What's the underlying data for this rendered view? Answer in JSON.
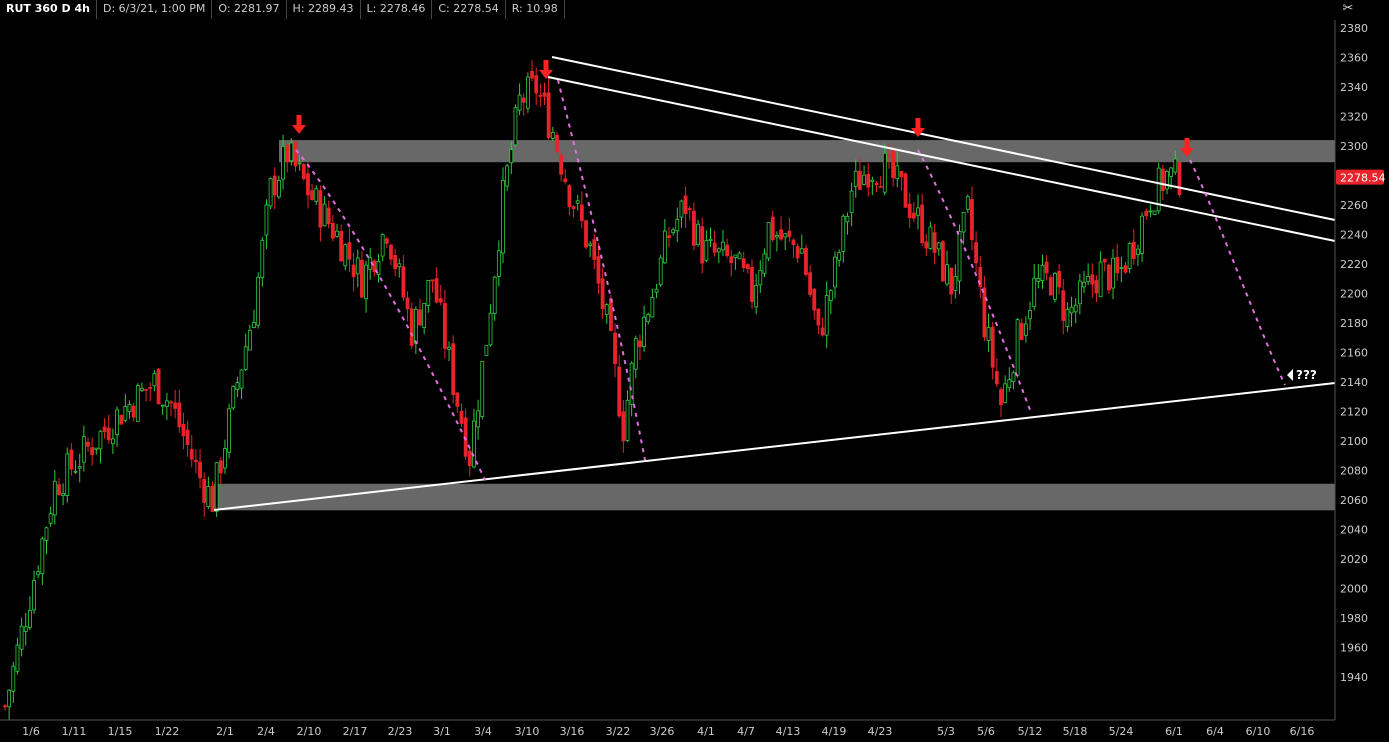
{
  "header": {
    "symbol": "RUT 360 D 4h",
    "date": "D: 6/3/21, 1:00 PM",
    "open": "O: 2281.97",
    "high": "H: 2289.43",
    "low": "L: 2278.46",
    "close": "C: 2278.54",
    "range": "R: 10.98"
  },
  "settings_icon": "settings-wrench-icon",
  "colors": {
    "background": "#000000",
    "up_candle": "#2ecc40",
    "down_candle": "#e8232b",
    "trendline": "#ffffff",
    "zone": "#7a7a7a",
    "projection": "#e070e0",
    "marker": "#ff2020",
    "price_badge": "#e8232b"
  },
  "chart_data": {
    "type": "candlestick",
    "ylim": [
      1910,
      2390
    ],
    "y_ticks": [
      1940,
      1960,
      1980,
      2000,
      2020,
      2040,
      2060,
      2080,
      2100,
      2120,
      2140,
      2160,
      2180,
      2200,
      2220,
      2240,
      2260,
      2280,
      2300,
      2320,
      2340,
      2360,
      2380
    ],
    "x_ticks": [
      "1/6",
      "1/11",
      "1/15",
      "1/22",
      "2/1",
      "2/4",
      "2/10",
      "2/17",
      "2/23",
      "3/1",
      "3/4",
      "3/10",
      "3/16",
      "3/22",
      "3/26",
      "4/1",
      "4/7",
      "4/13",
      "4/19",
      "4/23",
      "5/3",
      "5/6",
      "5/12",
      "5/18",
      "5/24",
      "6/1",
      "6/4",
      "6/10",
      "6/16"
    ],
    "last_price": "2278.54",
    "annotation": "???",
    "zones": [
      {
        "name": "resistance-zone",
        "low": 2289,
        "high": 2304
      },
      {
        "name": "support-zone",
        "low": 2053,
        "high": 2071
      }
    ],
    "anchors": [
      {
        "t": 0,
        "c": 1920
      },
      {
        "t": 6,
        "c": 1995
      },
      {
        "t": 12,
        "c": 2070
      },
      {
        "t": 20,
        "c": 2095
      },
      {
        "t": 28,
        "c": 2120
      },
      {
        "t": 36,
        "c": 2140
      },
      {
        "t": 40,
        "c": 2125
      },
      {
        "t": 47,
        "c": 2075
      },
      {
        "t": 50,
        "c": 2060
      },
      {
        "t": 56,
        "c": 2140
      },
      {
        "t": 60,
        "c": 2190
      },
      {
        "t": 64,
        "c": 2270
      },
      {
        "t": 68,
        "c": 2295
      },
      {
        "t": 74,
        "c": 2265
      },
      {
        "t": 80,
        "c": 2240
      },
      {
        "t": 86,
        "c": 2210
      },
      {
        "t": 92,
        "c": 2245
      },
      {
        "t": 98,
        "c": 2175
      },
      {
        "t": 103,
        "c": 2210
      },
      {
        "t": 108,
        "c": 2140
      },
      {
        "t": 112,
        "c": 2090
      },
      {
        "t": 116,
        "c": 2170
      },
      {
        "t": 120,
        "c": 2265
      },
      {
        "t": 124,
        "c": 2330
      },
      {
        "t": 128,
        "c": 2340
      },
      {
        "t": 132,
        "c": 2310
      },
      {
        "t": 136,
        "c": 2270
      },
      {
        "t": 141,
        "c": 2230
      },
      {
        "t": 145,
        "c": 2180
      },
      {
        "t": 149,
        "c": 2110
      },
      {
        "t": 152,
        "c": 2165
      },
      {
        "t": 156,
        "c": 2200
      },
      {
        "t": 160,
        "c": 2240
      },
      {
        "t": 164,
        "c": 2260
      },
      {
        "t": 168,
        "c": 2230
      },
      {
        "t": 172,
        "c": 2225
      },
      {
        "t": 176,
        "c": 2220
      },
      {
        "t": 180,
        "c": 2200
      },
      {
        "t": 184,
        "c": 2245
      },
      {
        "t": 188,
        "c": 2235
      },
      {
        "t": 192,
        "c": 2230
      },
      {
        "t": 196,
        "c": 2170
      },
      {
        "t": 200,
        "c": 2215
      },
      {
        "t": 204,
        "c": 2270
      },
      {
        "t": 208,
        "c": 2285
      },
      {
        "t": 212,
        "c": 2285
      },
      {
        "t": 216,
        "c": 2270
      },
      {
        "t": 220,
        "c": 2250
      },
      {
        "t": 224,
        "c": 2230
      },
      {
        "t": 228,
        "c": 2205
      },
      {
        "t": 232,
        "c": 2255
      },
      {
        "t": 236,
        "c": 2180
      },
      {
        "t": 240,
        "c": 2125
      },
      {
        "t": 244,
        "c": 2170
      },
      {
        "t": 248,
        "c": 2205
      },
      {
        "t": 252,
        "c": 2210
      },
      {
        "t": 256,
        "c": 2185
      },
      {
        "t": 260,
        "c": 2200
      },
      {
        "t": 264,
        "c": 2215
      },
      {
        "t": 268,
        "c": 2210
      },
      {
        "t": 272,
        "c": 2235
      },
      {
        "t": 276,
        "c": 2265
      },
      {
        "t": 280,
        "c": 2280
      },
      {
        "t": 283,
        "c": 2278.54
      }
    ]
  }
}
